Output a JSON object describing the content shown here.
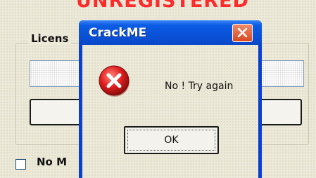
{
  "background": {
    "status_text": "UNREGISTERED",
    "group_label": "Licens",
    "checkbox_label": "No M"
  },
  "dialog": {
    "title": "CrackME",
    "message": "No ! Try again",
    "ok_label": "OK",
    "icon": "error-icon",
    "close_icon": "close-icon"
  },
  "colors": {
    "title_bar": "#0a52d8",
    "close_button": "#d8481f",
    "status_text": "#ff2a2a",
    "error_icon": "#c81818"
  }
}
